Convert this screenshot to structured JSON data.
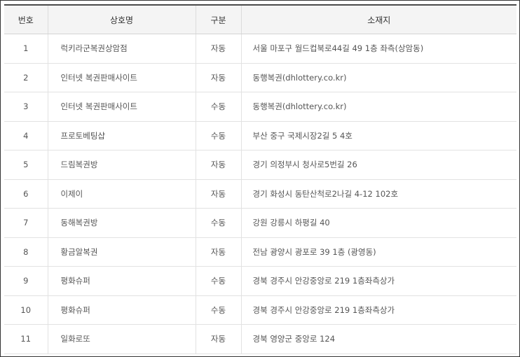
{
  "table": {
    "headers": {
      "number": "번호",
      "name": "상호명",
      "type": "구분",
      "address": "소재지"
    },
    "rows": [
      {
        "number": "1",
        "name": "럭키라군복권상암점",
        "type": "자동",
        "address": "서울 마포구 월드컵북로44길 49 1층 좌측(상암동)"
      },
      {
        "number": "2",
        "name": "인터넷 복권판매사이트",
        "type": "자동",
        "address": "동행복권(dhlottery.co.kr)"
      },
      {
        "number": "3",
        "name": "인터넷 복권판매사이트",
        "type": "수동",
        "address": "동행복권(dhlottery.co.kr)"
      },
      {
        "number": "4",
        "name": "프로토베팅샵",
        "type": "수동",
        "address": "부산 중구 국제시장2길 5 4호"
      },
      {
        "number": "5",
        "name": "드림복권방",
        "type": "자동",
        "address": "경기 의정부시 청사로5번길 26"
      },
      {
        "number": "6",
        "name": "이제이",
        "type": "자동",
        "address": "경기 화성시 동탄산척로2나길 4-12 102호"
      },
      {
        "number": "7",
        "name": "동해복권방",
        "type": "수동",
        "address": "강원 강릉시 하평길 40"
      },
      {
        "number": "8",
        "name": "황금알복권",
        "type": "자동",
        "address": "전남 광양시 광포로 39 1층 (광영동)"
      },
      {
        "number": "9",
        "name": "평화슈퍼",
        "type": "수동",
        "address": "경북 경주시 안강중앙로 219 1층좌측상가"
      },
      {
        "number": "10",
        "name": "평화슈퍼",
        "type": "수동",
        "address": "경북 경주시 안강중앙로 219 1층좌측상가"
      },
      {
        "number": "11",
        "name": "일화로또",
        "type": "자동",
        "address": "경북 영양군 중앙로 124"
      }
    ]
  }
}
